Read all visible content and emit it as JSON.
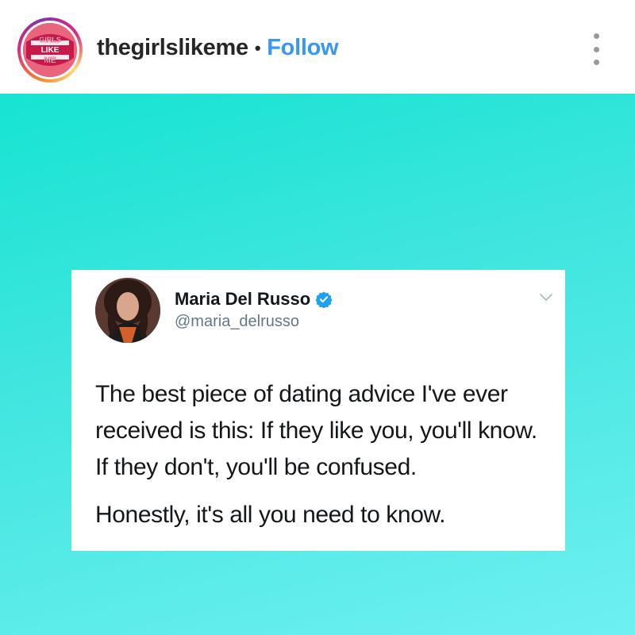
{
  "header": {
    "username": "thegirlslikeme",
    "separator": "•",
    "follow_label": "Follow",
    "avatar_logo_text": "GIRLS LIKE ME",
    "more_icon": "more-vertical-icon"
  },
  "post": {
    "background_colors": [
      "#16e4d2",
      "#6ef0f0"
    ],
    "tweet": {
      "author_name": "Maria Del Russo",
      "author_handle": "@maria_delrusso",
      "verified": true,
      "text_line_1": "The best piece of dating advice I've ever received is this: If they like you, you'll know. If they don't, you'll be confused.",
      "text_line_2": "Honestly, it's all you need to know."
    }
  },
  "colors": {
    "follow": "#3897f0",
    "verified": "#1da1f2",
    "username": "#262626",
    "handle": "#657786"
  }
}
